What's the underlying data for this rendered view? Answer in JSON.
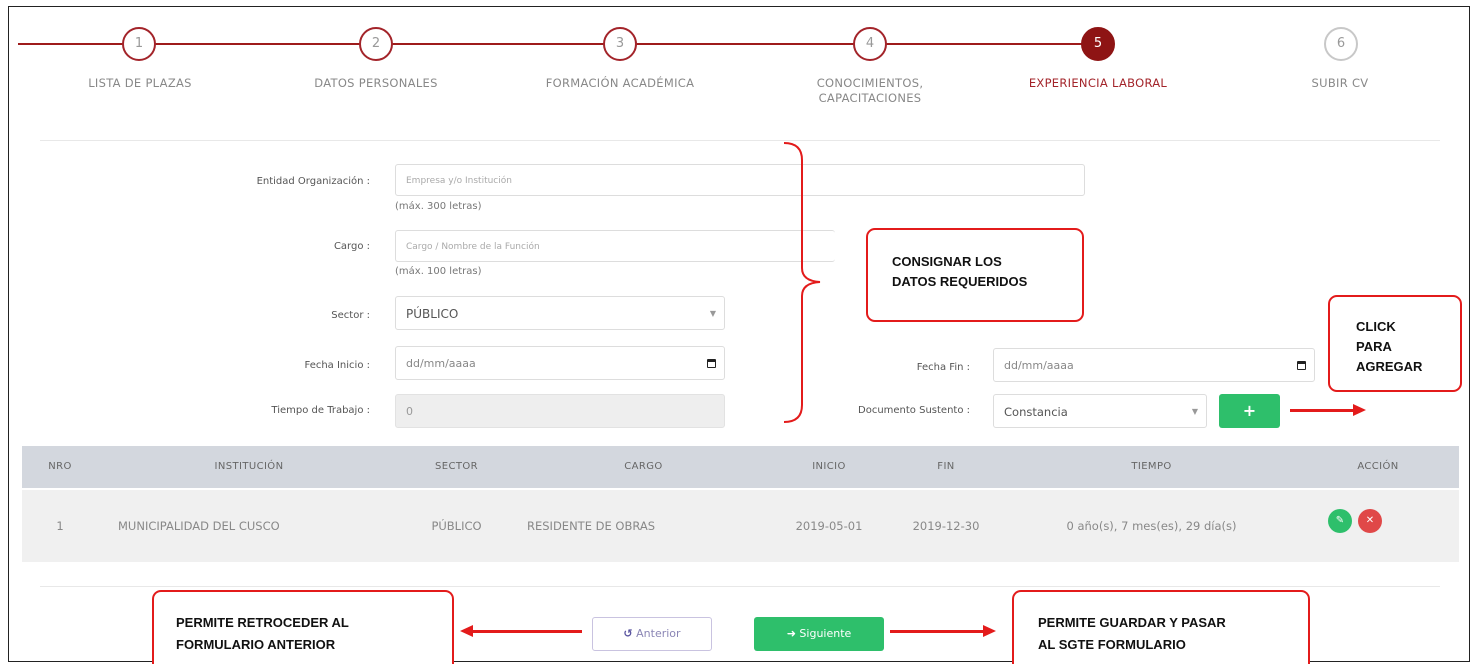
{
  "stepper": {
    "steps": [
      {
        "number": "1",
        "label": "LISTA DE PLAZAS"
      },
      {
        "number": "2",
        "label": "DATOS PERSONALES"
      },
      {
        "number": "3",
        "label": "FORMACIÓN ACADÉMICA"
      },
      {
        "number": "4",
        "label_line1": "CONOCIMIENTOS,",
        "label_line2": "CAPACITACIONES"
      },
      {
        "number": "5",
        "label": "EXPERIENCIA LABORAL"
      },
      {
        "number": "6",
        "label": "SUBIR CV"
      }
    ]
  },
  "form": {
    "entidad": {
      "label": "Entidad Organización :",
      "placeholder": "Empresa y/o Institución",
      "hint": "(máx. 300 letras)"
    },
    "cargo": {
      "label": "Cargo :",
      "placeholder": "Cargo / Nombre de la Función",
      "hint": "(máx. 100 letras)"
    },
    "sector": {
      "label": "Sector :",
      "value": "PÚBLICO"
    },
    "fecha_inicio": {
      "label": "Fecha Inicio :",
      "placeholder": "dd/mm/aaaa"
    },
    "fecha_fin": {
      "label": "Fecha Fin :",
      "placeholder": "dd/mm/aaaa"
    },
    "tiempo": {
      "label": "Tiempo de Trabajo :",
      "value": "0"
    },
    "documento": {
      "label": "Documento Sustento :",
      "value": "Constancia"
    },
    "add_button": "+"
  },
  "table": {
    "headers": [
      "NRO",
      "INSTITUCIÓN",
      "SECTOR",
      "CARGO",
      "INICIO",
      "FIN",
      "TIEMPO",
      "ACCIÓN"
    ],
    "rows": [
      {
        "nro": "1",
        "institucion": "MUNICIPALIDAD DEL CUSCO",
        "sector": "PÚBLICO",
        "cargo": "RESIDENTE DE OBRAS",
        "inicio": "2019-05-01",
        "fin": "2019-12-30",
        "tiempo": "0 año(s), 7 mes(es), 29 día(s)"
      }
    ]
  },
  "nav": {
    "anterior": "Anterior",
    "siguiente": "Siguiente"
  },
  "annotations": {
    "consignar_line1": "CONSIGNAR LOS",
    "consignar_line2": "DATOS REQUERIDOS",
    "click_line1": "CLICK",
    "click_line2": "PARA",
    "click_line3": "AGREGAR",
    "retroceder_line1": "PERMITE  RETROCEDER AL",
    "retroceder_line2": "FORMULARIO ANTERIOR",
    "guardar_line1": "PERMITE  GUARDAR Y PASAR",
    "guardar_line2": "AL SGTE FORMULARIO"
  },
  "colors": {
    "primary": "#8e1414",
    "accent_green": "#2ebf6b",
    "danger": "#e04848",
    "annotation_red": "#e31b1b",
    "table_header": "#d3d7de"
  }
}
